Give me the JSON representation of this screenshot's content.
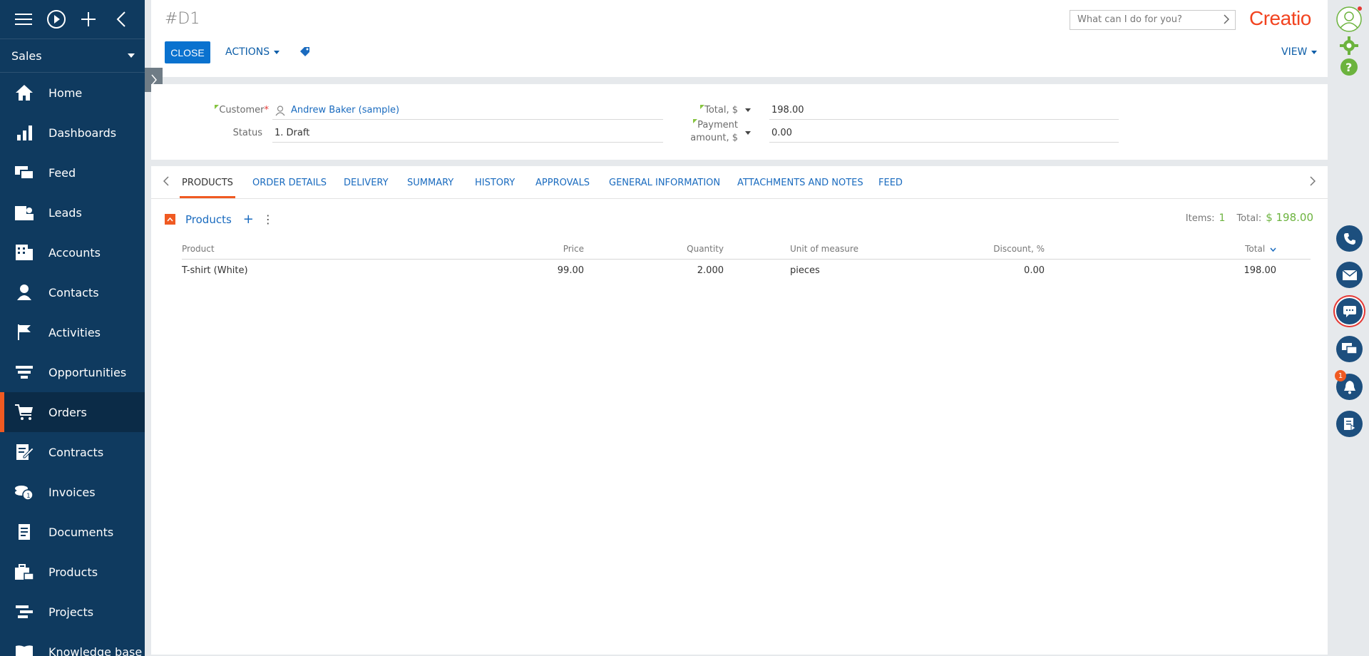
{
  "sidebar": {
    "workplace": "Sales",
    "items": [
      {
        "label": "Home",
        "icon": "home-icon"
      },
      {
        "label": "Dashboards",
        "icon": "dashboards-icon"
      },
      {
        "label": "Feed",
        "icon": "feed-icon"
      },
      {
        "label": "Leads",
        "icon": "leads-icon"
      },
      {
        "label": "Accounts",
        "icon": "accounts-icon"
      },
      {
        "label": "Contacts",
        "icon": "contacts-icon"
      },
      {
        "label": "Activities",
        "icon": "activities-icon"
      },
      {
        "label": "Opportunities",
        "icon": "opportunities-icon"
      },
      {
        "label": "Orders",
        "icon": "orders-icon"
      },
      {
        "label": "Contracts",
        "icon": "contracts-icon"
      },
      {
        "label": "Invoices",
        "icon": "invoices-icon"
      },
      {
        "label": "Documents",
        "icon": "documents-icon"
      },
      {
        "label": "Products",
        "icon": "products-icon"
      },
      {
        "label": "Projects",
        "icon": "projects-icon"
      },
      {
        "label": "Knowledge base",
        "icon": "knowledge-base-icon"
      }
    ],
    "active": "Orders"
  },
  "header": {
    "title": "#D1",
    "close_label": "CLOSE",
    "actions_label": "ACTIONS",
    "view_label": "VIEW",
    "search_placeholder": "What can I do for you?",
    "logo": "Creatio"
  },
  "fields": {
    "customer_label": "Customer",
    "customer_value": "Andrew Baker (sample)",
    "status_label": "Status",
    "status_value": "1. Draft",
    "total_label": "Total, $",
    "total_value": "198.00",
    "payment_label_1": "Payment",
    "payment_label_2": "amount, $",
    "payment_value": "0.00"
  },
  "tabs": [
    "PRODUCTS",
    "ORDER DETAILS",
    "DELIVERY",
    "SUMMARY",
    "HISTORY",
    "APPROVALS",
    "GENERAL INFORMATION",
    "ATTACHMENTS AND NOTES",
    "FEED"
  ],
  "products": {
    "title": "Products",
    "items_label": "Items:",
    "items_count": "1",
    "total_label": "Total:",
    "total_value": "$ 198.00",
    "columns": [
      "Product",
      "Price",
      "Quantity",
      "Unit of measure",
      "Discount, %",
      "Total"
    ],
    "rows": [
      [
        "T-shirt (White)",
        "99.00",
        "2.000",
        "pieces",
        "0.00",
        "198.00"
      ]
    ]
  },
  "notifications": {
    "badge": "1"
  },
  "colors": {
    "accent": "#f05a22",
    "sidebar": "#0f3a5f",
    "primary": "#0a72cf",
    "positive": "#6cb33e"
  }
}
